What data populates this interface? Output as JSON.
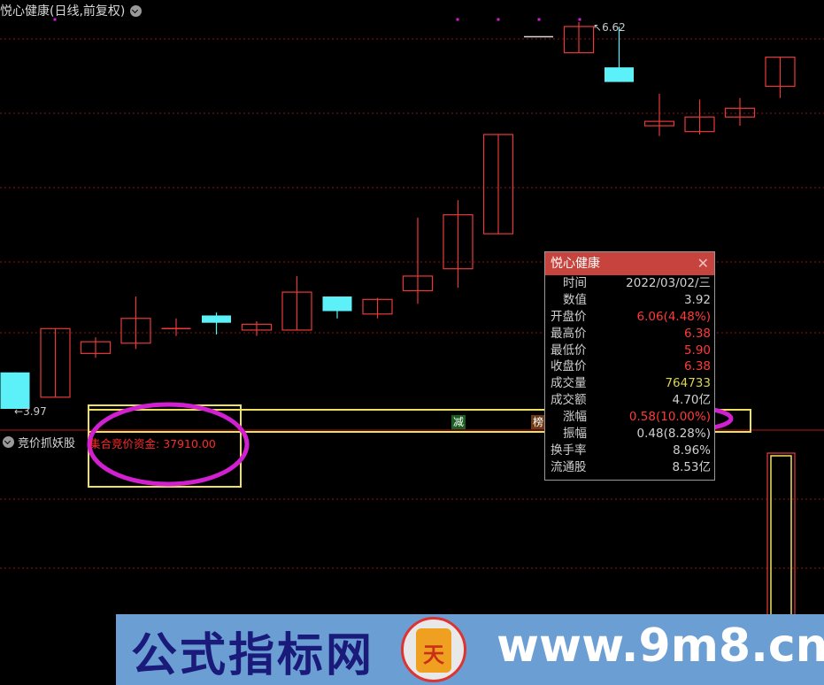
{
  "chart": {
    "title": "悦心健康(日线,前复权)",
    "high_label": "6.62",
    "low_label": "3.97"
  },
  "indicator": {
    "name": "竞价抓妖股",
    "fund_label": "集合竞价资金:",
    "fund_value": "37910.00",
    "tag_reduce": "减",
    "tag_rank": "榜"
  },
  "popup": {
    "title": "悦心健康",
    "close": "✕",
    "rows": [
      {
        "label": "时间",
        "value": "2022/03/02/三",
        "indent": true,
        "color": "white"
      },
      {
        "label": "数值",
        "value": "3.92",
        "indent": true,
        "color": "white"
      },
      {
        "label": "开盘价",
        "value": "6.06(4.48%)",
        "indent": false,
        "color": "red"
      },
      {
        "label": "最高价",
        "value": "6.38",
        "indent": false,
        "color": "red"
      },
      {
        "label": "最低价",
        "value": "5.90",
        "indent": false,
        "color": "red"
      },
      {
        "label": "收盘价",
        "value": "6.38",
        "indent": false,
        "color": "red"
      },
      {
        "label": "成交量",
        "value": "764733",
        "indent": false,
        "color": "yellow"
      },
      {
        "label": "成交额",
        "value": "4.70亿",
        "indent": false,
        "color": "white"
      },
      {
        "label": "涨幅",
        "value": "0.58(10.00%)",
        "indent": true,
        "color": "red"
      },
      {
        "label": "振幅",
        "value": "0.48(8.28%)",
        "indent": true,
        "color": "white"
      },
      {
        "label": "换手率",
        "value": "8.96%",
        "indent": false,
        "color": "white"
      },
      {
        "label": "流通股",
        "value": "8.53亿",
        "indent": false,
        "color": "white"
      }
    ]
  },
  "watermark": {
    "text": "公式指标网",
    "logo_text": "天",
    "url": "www.9m8.cn"
  },
  "colors": {
    "up": "#e83a3a",
    "down": "#5cf0f8",
    "highlight_box": "#f0e060",
    "annotation_circle": "#d020d0"
  },
  "chart_data": {
    "type": "candlestick",
    "series": [
      {
        "dir": "down",
        "open": 4.22,
        "close": 3.97,
        "high": 4.22,
        "low": 3.97
      },
      {
        "dir": "up",
        "open": 4.05,
        "close": 4.52,
        "high": 4.52,
        "low": 4.05
      },
      {
        "dir": "up",
        "open": 4.35,
        "close": 4.43,
        "high": 4.46,
        "low": 4.32
      },
      {
        "dir": "up",
        "open": 4.42,
        "close": 4.59,
        "high": 4.74,
        "low": 4.38
      },
      {
        "dir": "flat",
        "open": 4.52,
        "close": 4.52,
        "high": 4.59,
        "low": 4.47
      },
      {
        "dir": "down",
        "open": 4.61,
        "close": 4.56,
        "high": 4.63,
        "low": 4.48
      },
      {
        "dir": "up",
        "open": 4.51,
        "close": 4.55,
        "high": 4.57,
        "low": 4.47
      },
      {
        "dir": "up",
        "open": 4.51,
        "close": 4.77,
        "high": 4.88,
        "low": 4.51
      },
      {
        "dir": "down",
        "open": 4.74,
        "close": 4.64,
        "high": 4.74,
        "low": 4.59
      },
      {
        "dir": "up",
        "open": 4.62,
        "close": 4.72,
        "high": 4.73,
        "low": 4.59
      },
      {
        "dir": "up",
        "open": 4.78,
        "close": 4.88,
        "high": 5.28,
        "low": 4.69
      },
      {
        "dir": "up",
        "open": 4.93,
        "close": 5.3,
        "high": 5.4,
        "low": 4.8
      },
      {
        "dir": "up",
        "open": 5.17,
        "close": 5.85,
        "high": 5.85,
        "low": 5.17
      },
      {
        "dir": "flat",
        "open": 6.52,
        "close": 6.52,
        "high": 6.52,
        "low": 6.52
      },
      {
        "dir": "up",
        "open": 6.41,
        "close": 6.59,
        "high": 6.62,
        "low": 6.41
      },
      {
        "dir": "down",
        "open": 6.31,
        "close": 6.21,
        "high": 6.59,
        "low": 6.21
      },
      {
        "dir": "up",
        "open": 5.91,
        "close": 5.94,
        "high": 6.13,
        "low": 5.84
      },
      {
        "dir": "up",
        "open": 5.87,
        "close": 5.97,
        "high": 6.09,
        "low": 5.85
      },
      {
        "dir": "up",
        "open": 5.97,
        "close": 6.03,
        "high": 6.1,
        "low": 5.91
      },
      {
        "dir": "up",
        "open": 6.18,
        "close": 6.38,
        "high": 6.38,
        "low": 6.1
      }
    ]
  }
}
